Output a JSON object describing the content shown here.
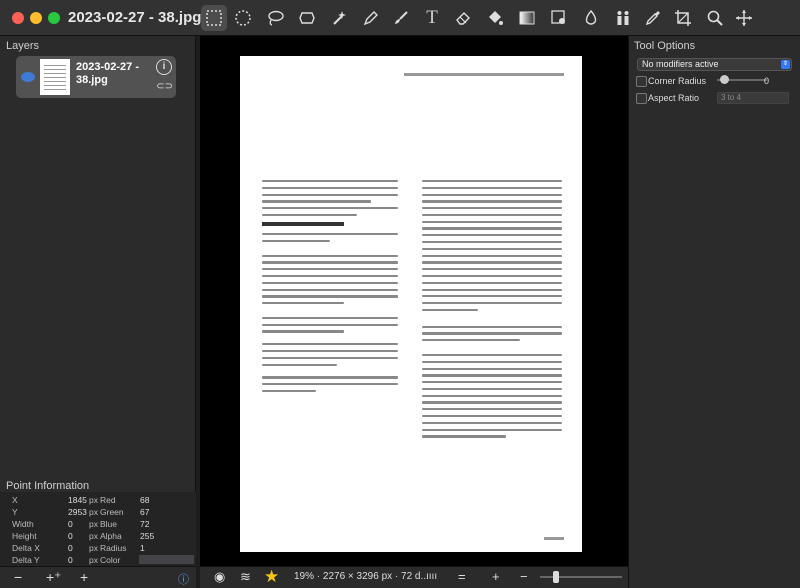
{
  "window": {
    "title": "2023-02-27 - 38.jpg"
  },
  "toolbar": {
    "tools": [
      {
        "name": "rect-select-icon",
        "selected": true
      },
      {
        "name": "ellipse-select-icon",
        "selected": false
      },
      {
        "name": "lasso-icon",
        "selected": false
      },
      {
        "name": "polygon-lasso-icon",
        "selected": false
      },
      {
        "name": "magic-wand-icon",
        "selected": false
      },
      {
        "name": "pen-icon",
        "selected": false
      },
      {
        "name": "brush-icon",
        "selected": false
      },
      {
        "name": "text-icon",
        "selected": false
      },
      {
        "name": "eraser-icon",
        "selected": false
      },
      {
        "name": "paint-bucket-icon",
        "selected": false
      },
      {
        "name": "gradient-icon",
        "selected": false
      },
      {
        "name": "clone-stamp-icon",
        "selected": false
      },
      {
        "name": "blur-drop-icon",
        "selected": false
      },
      {
        "name": "figures-icon",
        "selected": false
      },
      {
        "name": "eyedropper-icon",
        "selected": false
      },
      {
        "name": "crop-icon",
        "selected": false
      },
      {
        "name": "zoom-icon",
        "selected": false
      },
      {
        "name": "move-icon",
        "selected": false
      }
    ],
    "text_tool_glyph": "T"
  },
  "layers": {
    "title": "Layers",
    "items": [
      {
        "name": "2023-02-27 - 38.jpg"
      }
    ]
  },
  "point_info": {
    "title": "Point Information",
    "rows": [
      {
        "l1": "X",
        "v1": "1845",
        "u1": "px",
        "l2": "Red",
        "v2": "68"
      },
      {
        "l1": "Y",
        "v1": "2953",
        "u1": "px",
        "l2": "Green",
        "v2": "67"
      },
      {
        "l1": "Width",
        "v1": "0",
        "u1": "px",
        "l2": "Blue",
        "v2": "72"
      },
      {
        "l1": "Height",
        "v1": "0",
        "u1": "px",
        "l2": "Alpha",
        "v2": "255"
      },
      {
        "l1": "Delta X",
        "v1": "0",
        "u1": "px",
        "l2": "Radius",
        "v2": "1"
      },
      {
        "l1": "Delta Y",
        "v1": "0",
        "u1": "px",
        "l2": "Color",
        "v2": ""
      }
    ],
    "color_value": "#444448"
  },
  "status": {
    "info": "19% · 2276 × 3296 px · 72 d..."
  },
  "tool_options": {
    "title": "Tool Options",
    "modifier": "No modifiers active",
    "corner_radius_label": "Corner Radius",
    "corner_radius_value": "0",
    "aspect_ratio_label": "Aspect Ratio",
    "aspect_ratio_value": "3 to 4"
  }
}
